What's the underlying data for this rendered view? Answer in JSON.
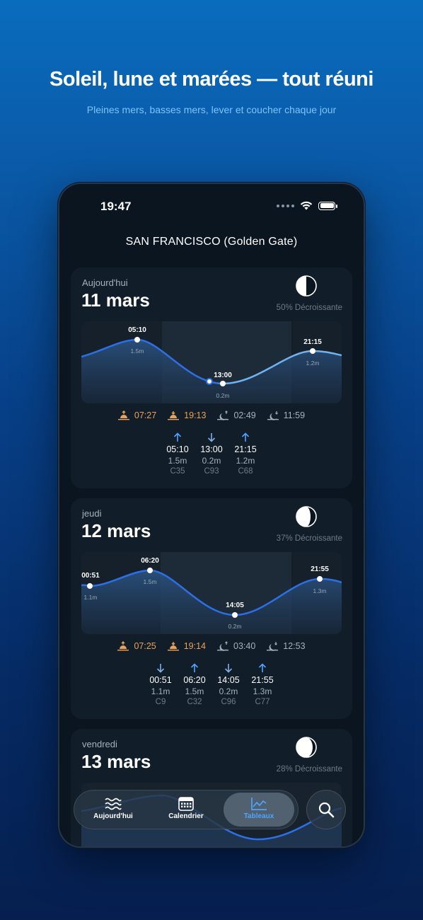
{
  "hero": {
    "title": "Soleil, lune et marées — tout réuni",
    "subtitle": "Pleines mers, basses mers, lever et coucher chaque jour"
  },
  "status_bar": {
    "time": "19:47"
  },
  "location": "SAN FRANCISCO (Golden Gate)",
  "days": [
    {
      "weekday": "Aujourd'hui",
      "date": "11 mars",
      "moon_label": "50% Décroissante",
      "sunrise": "07:27",
      "sunset": "19:13",
      "moonrise": "02:49",
      "moonset": "11:59",
      "tides": [
        {
          "direction": "up",
          "time": "05:10",
          "height": "1.5m",
          "coef": "C35"
        },
        {
          "direction": "down",
          "time": "13:00",
          "height": "0.2m",
          "coef": "C93"
        },
        {
          "direction": "up",
          "time": "21:15",
          "height": "1.2m",
          "coef": "C68"
        }
      ]
    },
    {
      "weekday": "jeudi",
      "date": "12 mars",
      "moon_label": "37% Décroissante",
      "sunrise": "07:25",
      "sunset": "19:14",
      "moonrise": "03:40",
      "moonset": "12:53",
      "tides": [
        {
          "direction": "down",
          "time": "00:51",
          "height": "1.1m",
          "coef": "C9"
        },
        {
          "direction": "up",
          "time": "06:20",
          "height": "1.5m",
          "coef": "C32"
        },
        {
          "direction": "down",
          "time": "14:05",
          "height": "0.2m",
          "coef": "C96"
        },
        {
          "direction": "up",
          "time": "21:55",
          "height": "1.3m",
          "coef": "C77"
        }
      ]
    },
    {
      "weekday": "vendredi",
      "date": "13 mars",
      "moon_label": "28% Décroissante"
    }
  ],
  "tab_bar": {
    "items": [
      {
        "label": "Aujourd'hui",
        "icon": "waves-icon",
        "active": false
      },
      {
        "label": "Calendrier",
        "icon": "calendar-icon",
        "active": false
      },
      {
        "label": "Tableaux",
        "icon": "chart-icon",
        "active": true
      }
    ],
    "search_icon": "magnifier-icon"
  },
  "colors": {
    "accent": "#4fa4ff",
    "sun": "#e8a25b",
    "background_top": "#0a6cbd",
    "background_bottom": "#061f4f",
    "card": "#111d28"
  }
}
